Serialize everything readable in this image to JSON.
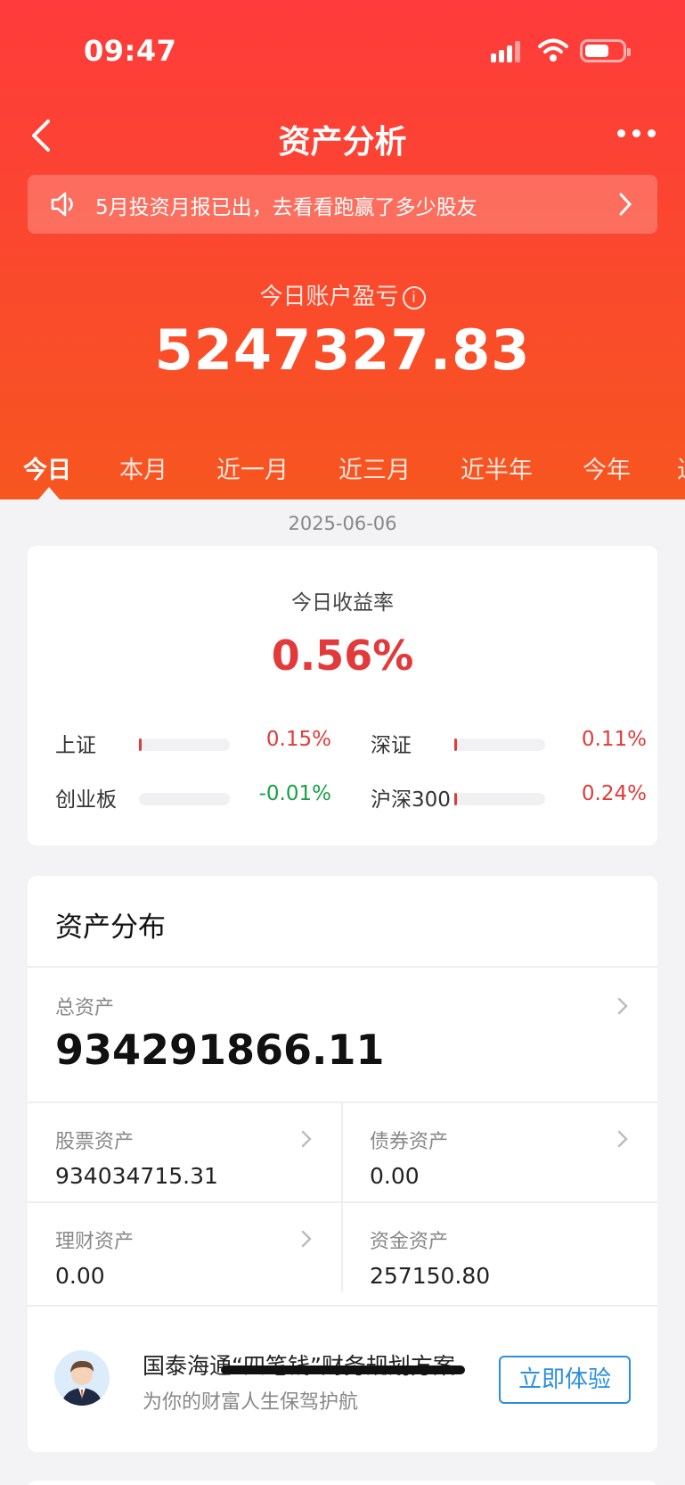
{
  "status_bar": {
    "time": "09:47"
  },
  "nav": {
    "title": "资产分析"
  },
  "notice": {
    "text": "5月投资月报已出，去看看跑赢了多少股友"
  },
  "pnl": {
    "label": "今日账户盈亏",
    "info_icon": "i",
    "value": "5247327.83"
  },
  "tabs": [
    {
      "label": "今日",
      "active": true
    },
    {
      "label": "本月"
    },
    {
      "label": "近一月"
    },
    {
      "label": "近三月"
    },
    {
      "label": "近半年"
    },
    {
      "label": "今年"
    },
    {
      "label": "近"
    }
  ],
  "date": "2025-06-06",
  "returns": {
    "label": "今日收益率",
    "value": "0.56%",
    "indices": [
      {
        "name": "上证",
        "pct": "0.15%",
        "trend": "up"
      },
      {
        "name": "深证",
        "pct": "0.11%",
        "trend": "up"
      },
      {
        "name": "创业板",
        "pct": "-0.01%",
        "trend": "down"
      },
      {
        "name": "沪深300",
        "pct": "0.24%",
        "trend": "up"
      }
    ]
  },
  "assets": {
    "title": "资产分布",
    "total_label": "总资产",
    "total_value": "934291866.11",
    "stock_label": "股票资产",
    "stock_value": "934034715.31",
    "bond_label": "债券资产",
    "bond_value": "0.00",
    "wealth_label": "理财资产",
    "wealth_value": "0.00",
    "cash_label": "资金资产",
    "cash_value": "257150.80"
  },
  "promo": {
    "title": "国泰海通“四笔钱”财务规划方案",
    "subtitle": "为你的财富人生保驾护航",
    "button": "立即体验"
  },
  "colors": {
    "brand": "#ff3b3b",
    "up": "#e23a3a",
    "down": "#18a146",
    "link": "#2b8fe0"
  }
}
